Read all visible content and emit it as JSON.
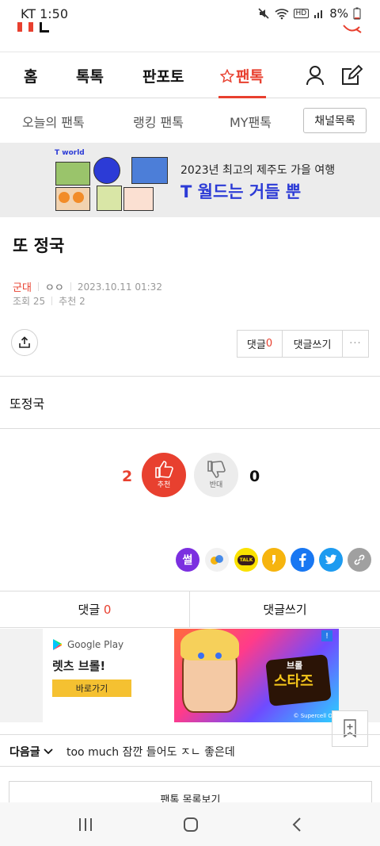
{
  "status_bar": {
    "carrier_time": "KT 1:50",
    "battery": "8%",
    "net_badge": "HD"
  },
  "nav": {
    "items": [
      "홈",
      "톡톡",
      "판포토",
      "팬톡"
    ],
    "active": "팬톡"
  },
  "subnav": {
    "items": [
      "오늘의 팬톡",
      "랭킹 팬톡",
      "MY팬톡"
    ],
    "channel_button": "채널목록"
  },
  "banner": {
    "brand": "T world",
    "line1": "2023년 최고의 제주도 가을 여행",
    "line2": "T 월드는 거들 뿐"
  },
  "post": {
    "title": "또 정국",
    "category": "군대",
    "author": "ㅇㅇ",
    "date": "2023.10.11 01:32",
    "views": "조회 25",
    "recommend": "추천 2",
    "body": "또정국"
  },
  "actions": {
    "comment_label": "댓글",
    "comment_count": "0",
    "write_comment": "댓글쓰기",
    "more": "···"
  },
  "vote": {
    "up_count": "2",
    "up_label": "추천",
    "down_count": "0",
    "down_label": "반대"
  },
  "share_icons": [
    "ssul-icon",
    "cyworld-icon",
    "kakaotalk-icon",
    "kakaostory-icon",
    "facebook-icon",
    "twitter-icon",
    "link-icon"
  ],
  "share_talk_text": "TALK",
  "share_ssul_text": "썰",
  "comment_bar": {
    "label": "댓글",
    "count": "0",
    "write": "댓글쓰기"
  },
  "ad": {
    "store": "Google Play",
    "name": "렛츠 브롤!",
    "cta": "바로가기",
    "logo_top": "브롤",
    "logo_main": "스타즈",
    "copyright": "© Supercell Oy"
  },
  "next_post": {
    "label": "다음글",
    "title": "too much 잠깐 들어도 ㅈㄴ 좋은데"
  },
  "list_button": "팬톡 목록보기",
  "colors": {
    "accent": "#e8402f",
    "banner_blue": "#2c3bd6"
  }
}
